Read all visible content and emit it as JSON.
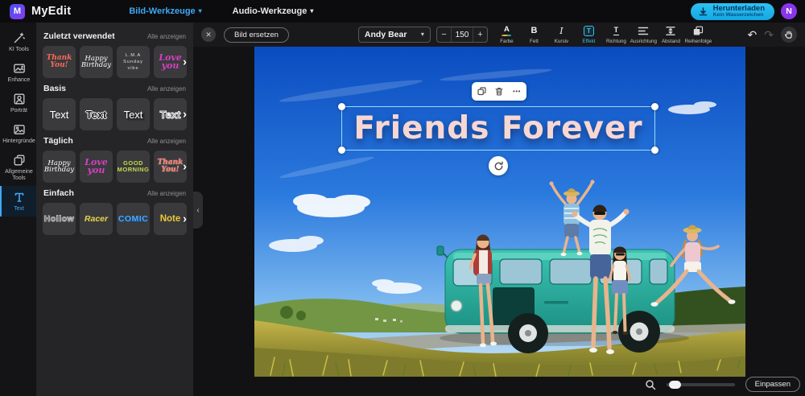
{
  "topbar": {
    "logo_letter": "M",
    "brand": "MyEdit",
    "nav": [
      {
        "label": "Bild-Werkzeuge",
        "active": true
      },
      {
        "label": "Audio-Werkzeuge",
        "active": false
      }
    ],
    "download": {
      "label": "Herunterladen",
      "sublabel": "Kein Wasserzeichen"
    },
    "avatar_initial": "N"
  },
  "sidebar": {
    "items": [
      {
        "label": "KI Tools",
        "icon": "magic-wand-icon"
      },
      {
        "label": "Enhance",
        "icon": "photo-enhance-icon"
      },
      {
        "label": "Porträt",
        "icon": "portrait-icon"
      },
      {
        "label": "Hintergründe",
        "icon": "background-image-icon"
      },
      {
        "label": "Allgemeine Tools",
        "icon": "general-tools-icon"
      },
      {
        "label": "Text",
        "icon": "text-icon",
        "active": true
      }
    ]
  },
  "panel": {
    "show_all_label": "Alle anzeigen",
    "sections": [
      {
        "title": "Zuletzt verwendet",
        "items": [
          {
            "text": "Thank You!"
          },
          {
            "text": "Happy Birthday"
          },
          {
            "text": "L.M.A\nSunday vibe"
          },
          {
            "text": "Love you"
          }
        ]
      },
      {
        "title": "Basis",
        "items": [
          {
            "text": "Text"
          },
          {
            "text": "Text"
          },
          {
            "text": "Text"
          },
          {
            "text": "Text"
          }
        ]
      },
      {
        "title": "Täglich",
        "items": [
          {
            "text": "Happy Birthday"
          },
          {
            "text": "Love you"
          },
          {
            "text": "GOOD MORNING"
          },
          {
            "text": "Thank You!"
          }
        ]
      },
      {
        "title": "Einfach",
        "items": [
          {
            "text": "Hollow"
          },
          {
            "text": "Racer"
          },
          {
            "text": "COMIC"
          },
          {
            "text": "Note"
          }
        ]
      }
    ]
  },
  "toolbar": {
    "replace_image_label": "Bild ersetzen",
    "font_name": "Andy Bear",
    "font_size": "150",
    "tools": [
      {
        "label": "Farbe",
        "glyph": "A",
        "icon": "text-color-icon"
      },
      {
        "label": "Fett",
        "glyph": "B",
        "icon": "bold-icon"
      },
      {
        "label": "Kursiv",
        "glyph": "I",
        "icon": "italic-icon"
      },
      {
        "label": "Effekt",
        "glyph": "T",
        "icon": "text-effect-icon",
        "active": true
      },
      {
        "label": "Richtung",
        "glyph": "T",
        "icon": "text-direction-icon"
      },
      {
        "label": "Ausrichtung",
        "icon": "text-align-icon"
      },
      {
        "label": "Abstand",
        "icon": "letter-spacing-icon"
      },
      {
        "label": "Reihenfolge",
        "icon": "layer-order-icon"
      }
    ]
  },
  "canvas": {
    "overlay_text": "Friends Forever"
  },
  "zoombar": {
    "fit_label": "Einpassen"
  },
  "icons": {
    "close": "✕",
    "minus": "−",
    "plus": "+",
    "caret": "▾",
    "more": "•••",
    "chevron_right": "›",
    "chevron_left": "‹",
    "undo": "↶",
    "redo": "↷"
  },
  "colors": {
    "accent_blue": "#3fa9f5",
    "effect_cyan": "#35c3f2",
    "download_cyan": "#1fb5ea",
    "avatar_purple": "#8a35ea",
    "selection_cyan": "#9adcf5",
    "overlay_text_pink": "#f8d7d2",
    "van_teal": "#28b0a0"
  }
}
